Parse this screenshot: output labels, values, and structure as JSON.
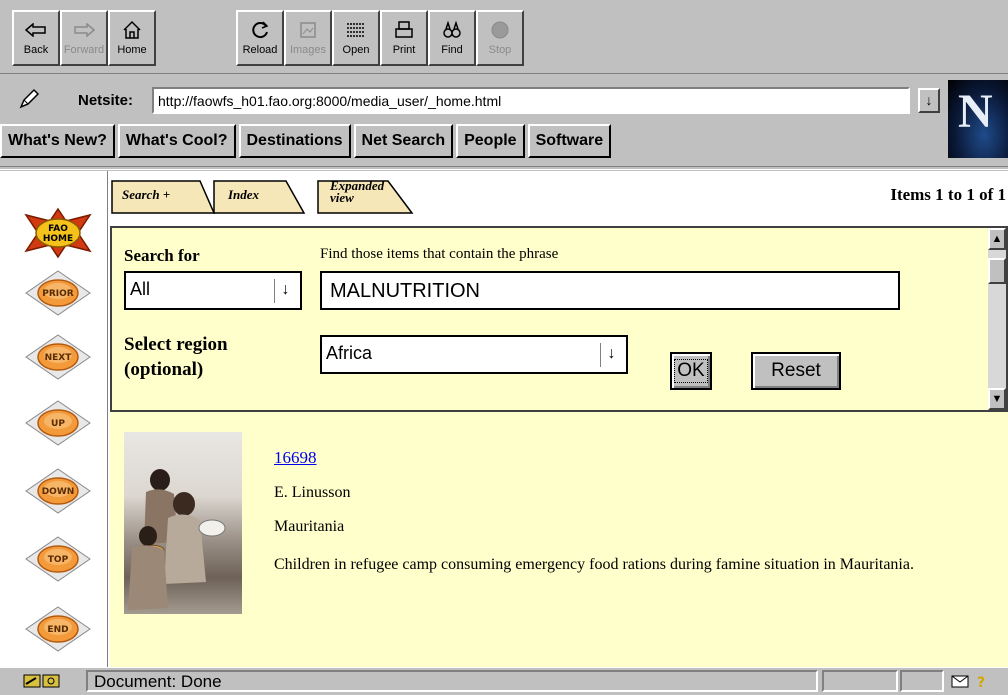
{
  "toolbar": {
    "back": "Back",
    "forward": "Forward",
    "home": "Home",
    "reload": "Reload",
    "images": "Images",
    "open": "Open",
    "print": "Print",
    "find": "Find",
    "stop": "Stop"
  },
  "location": {
    "label": "Netsite:",
    "url": "http://faowfs_h01.fao.org:8000/media_user/_home.html"
  },
  "logo_letter": "N",
  "directory": [
    "What's New?",
    "What's Cool?",
    "Destinations",
    "Net Search",
    "People",
    "Software"
  ],
  "nav": [
    "FAO HOME",
    "PRIOR",
    "NEXT",
    "UP",
    "DOWN",
    "TOP",
    "END"
  ],
  "tabs": {
    "search": "Search +",
    "index": "Index",
    "expanded_1": "Expanded",
    "expanded_2": "view"
  },
  "items_count": "Items 1 to 1 of 1",
  "search": {
    "search_for_label": "Search for",
    "search_for_value": "All",
    "phrase_label": "Find those items that  contain the phrase",
    "phrase_value": "MALNUTRITION",
    "region_label_1": "Select region",
    "region_label_2": "(optional)",
    "region_value": "Africa",
    "ok": "OK",
    "reset": "Reset"
  },
  "result": {
    "id": "16698",
    "author": "E. Linusson",
    "country": "Mauritania",
    "description": "Children in refugee camp consuming emergency food rations during famine situation in Mauritania."
  },
  "status": {
    "text": "Document: Done"
  }
}
